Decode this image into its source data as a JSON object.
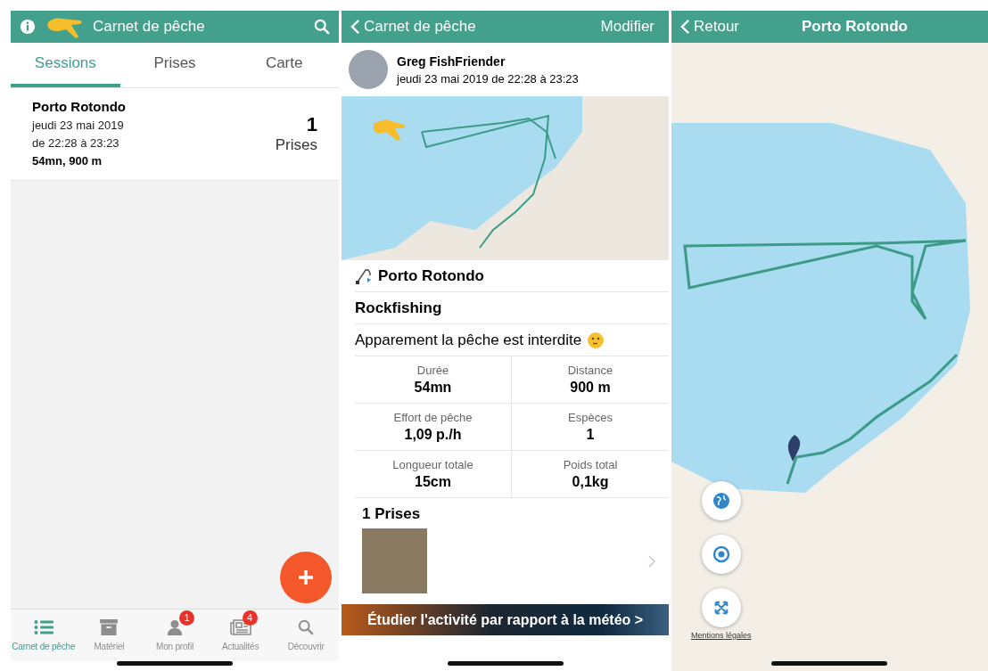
{
  "logbook_screen": {
    "header": {
      "title": "Carnet de pêche"
    },
    "tabs": [
      {
        "label": "Sessions",
        "selected": true
      },
      {
        "label": "Prises",
        "selected": false
      },
      {
        "label": "Carte",
        "selected": false
      }
    ],
    "sessions": [
      {
        "place": "Porto Rotondo",
        "date": "jeudi 23 mai 2019",
        "time": "de 22:28 à 23:23",
        "summary": "54mn, 900 m",
        "count": "1",
        "count_label": "Prises"
      }
    ],
    "bottom_nav": [
      {
        "label": "Carnet de pêche",
        "selected": true
      },
      {
        "label": "Matériel",
        "selected": false
      },
      {
        "label": "Mon profil",
        "selected": false,
        "badge": "1"
      },
      {
        "label": "Actualités",
        "selected": false,
        "badge": "4"
      },
      {
        "label": "Découvrir",
        "selected": false
      }
    ]
  },
  "session_screen": {
    "header": {
      "back": "Carnet de pêche",
      "action": "Modifier"
    },
    "author": {
      "name": "Greg FishFriender",
      "date": "jeudi 23 mai 2019 de 22:28 à 23:23"
    },
    "place": "Porto Rotondo",
    "technique": "Rockfishing",
    "note": "Apparement la pêche est interdite",
    "stats": [
      {
        "label": "Durée",
        "value": "54mn"
      },
      {
        "label": "Distance",
        "value": "900 m"
      },
      {
        "label": "Effort de pêche",
        "value": "1,09 p./h"
      },
      {
        "label": "Espèces",
        "value": "1"
      },
      {
        "label": "Longueur totale",
        "value": "15cm"
      },
      {
        "label": "Poids total",
        "value": "0,1kg"
      }
    ],
    "catches_title": "1 Prises",
    "banner": "Étudier l'activité par rapport à la météo >"
  },
  "map_screen": {
    "header": {
      "back": "Retour",
      "title": "Porto Rotondo"
    },
    "legal_link": "Mentions légales"
  }
}
